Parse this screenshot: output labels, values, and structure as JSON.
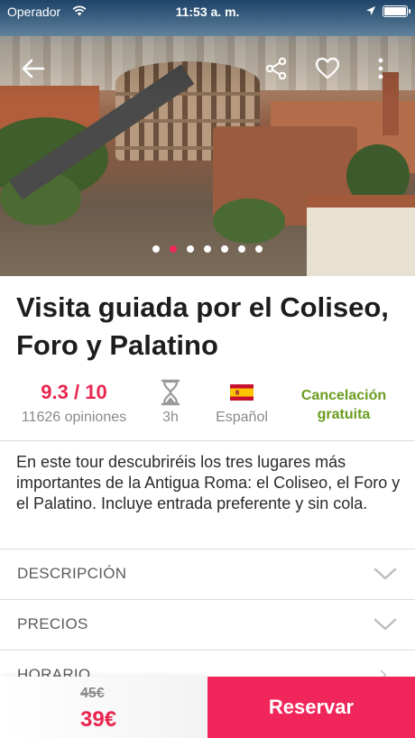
{
  "status_bar": {
    "carrier": "Operador",
    "time": "11:53 a. m."
  },
  "hero": {
    "image_subject": "Colosseum and Roman Forum aerial view",
    "carousel_dots": 7,
    "active_dot": 1
  },
  "nav": {
    "icons": [
      "back-arrow-icon",
      "share-icon",
      "heart-icon",
      "more-vertical-icon"
    ]
  },
  "tour": {
    "title": "Visita guiada por el Coliseo, Foro y Palatino",
    "rating": "9.3 / 10",
    "reviews": "11626 opiniones",
    "duration": "3h",
    "language": "Español",
    "cancellation": "Cancelación gratuita",
    "description": "En este tour descubriréis los tres lugares más importantes de la Antigua Roma: el Coliseo, el Foro y el Palatino. Incluye entrada preferente y sin cola."
  },
  "sections": [
    {
      "label": "DESCRIPCIÓN"
    },
    {
      "label": "PRECIOS"
    },
    {
      "label": "HORARIO"
    }
  ],
  "booking": {
    "old_price": "45€",
    "price": "39€",
    "button_label": "Reservar"
  },
  "colors": {
    "accent": "#f0265a",
    "rating": "#e8264f",
    "green": "#6b9c1f"
  }
}
